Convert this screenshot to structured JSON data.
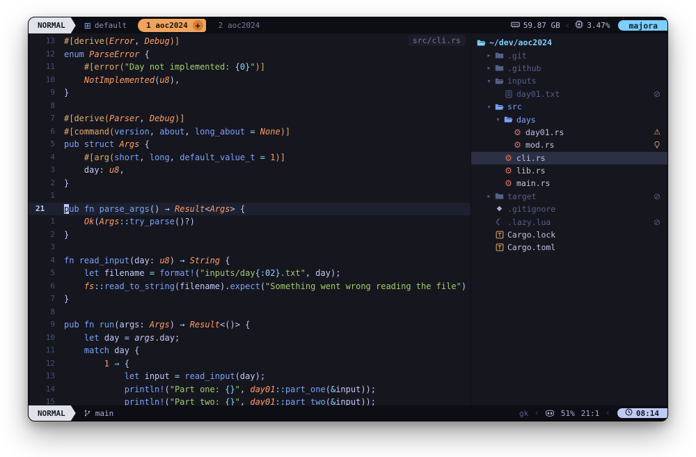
{
  "colors": {
    "bg": "#16161f",
    "bgDark": "#0d0e14",
    "fg": "#c0caf5",
    "uiFg": "#a9b1d6",
    "dim": "#565f89",
    "gutter": "#475072",
    "cursorline": "#1d202f",
    "selRow": "#2b3045",
    "badge": "#e0e2ea",
    "badgeText": "#15161e",
    "tabActive": "#efa45e",
    "tabActiveText": "#1f1204",
    "tabPlus": "#d87f35",
    "host": "#7dcfff",
    "kw": "#7aa2f7",
    "fn": "#7aa2f7",
    "ty": "#ff9e64",
    "st": "#9ece6a",
    "op": "#89ddff",
    "at": "#e0af68",
    "nu": "#ff9e64",
    "pa": "#7aa2f7",
    "warn": "#e0af68",
    "rust": "#e0705c",
    "folderBlue": "#7aa2f7",
    "toml": "#e0af68",
    "moon": "#7a84b8",
    "diamond": "#a6adc8",
    "timeBg": "#c0caf5"
  },
  "icons": {
    "grid": "⊞",
    "plus": "+",
    "sep": "‹",
    "chevOpen": "▾",
    "chevClosed": "▸",
    "ignored": "⊘",
    "warning": "⚠",
    "rust": "⚙",
    "diamond": "◆",
    "moon": "☾"
  },
  "tabline": {
    "mode": "NORMAL",
    "tabs": [
      {
        "label": "default"
      },
      {
        "label": "1 aoc2024",
        "active": true
      },
      {
        "label": "2 aoc2024"
      }
    ],
    "ram": "59.87 GB",
    "cpu": "3.47%",
    "host": "majora"
  },
  "editor": {
    "file_path": "src/cli.rs",
    "lines": [
      {
        "num": "13",
        "tokens": [
          [
            "at",
            "#[derive("
          ],
          [
            "ty",
            "Error"
          ],
          [
            "pu",
            ", "
          ],
          [
            "ty",
            "Debug"
          ],
          [
            "at",
            ")]"
          ]
        ]
      },
      {
        "num": "12",
        "tokens": [
          [
            "kw",
            "enum "
          ],
          [
            "ty",
            "ParseError"
          ],
          [
            "pu",
            " {"
          ]
        ]
      },
      {
        "num": "11",
        "tokens": [
          [
            "pu",
            "    "
          ],
          [
            "at",
            "#[error("
          ],
          [
            "st",
            "\"Day not implemented: "
          ],
          [
            "fm",
            "{0}"
          ],
          [
            "st",
            "\""
          ],
          [
            "at",
            ")]"
          ]
        ]
      },
      {
        "num": "10",
        "tokens": [
          [
            "pu",
            "    "
          ],
          [
            "ty",
            "NotImplemented"
          ],
          [
            "pu",
            "("
          ],
          [
            "ty",
            "u8"
          ],
          [
            "pu",
            "),"
          ]
        ]
      },
      {
        "num": "9",
        "tokens": [
          [
            "pu",
            "}"
          ]
        ]
      },
      {
        "num": "8",
        "tokens": []
      },
      {
        "num": "7",
        "tokens": [
          [
            "at",
            "#[derive("
          ],
          [
            "ty",
            "Parser"
          ],
          [
            "pu",
            ", "
          ],
          [
            "ty",
            "Debug"
          ],
          [
            "at",
            ")]"
          ]
        ]
      },
      {
        "num": "6",
        "tokens": [
          [
            "at",
            "#[command("
          ],
          [
            "pa",
            "version"
          ],
          [
            "pu",
            ", "
          ],
          [
            "pa",
            "about"
          ],
          [
            "pu",
            ", "
          ],
          [
            "pa",
            "long_about"
          ],
          [
            "op",
            " = "
          ],
          [
            "ty",
            "None"
          ],
          [
            "at",
            ")]"
          ]
        ]
      },
      {
        "num": "5",
        "tokens": [
          [
            "kw",
            "pub struct "
          ],
          [
            "ty",
            "Args"
          ],
          [
            "pu",
            " {"
          ]
        ]
      },
      {
        "num": "4",
        "tokens": [
          [
            "pu",
            "    "
          ],
          [
            "at",
            "#[arg("
          ],
          [
            "pa",
            "short"
          ],
          [
            "pu",
            ", "
          ],
          [
            "pa",
            "long"
          ],
          [
            "pu",
            ", "
          ],
          [
            "pa",
            "default_value_t"
          ],
          [
            "op",
            " = "
          ],
          [
            "nu",
            "1"
          ],
          [
            "at",
            ")]"
          ]
        ]
      },
      {
        "num": "3",
        "tokens": [
          [
            "pu",
            "    "
          ],
          [
            "tx",
            "day"
          ],
          [
            "pu",
            ": "
          ],
          [
            "ty",
            "u8"
          ],
          [
            "pu",
            ","
          ]
        ]
      },
      {
        "num": "2",
        "tokens": [
          [
            "pu",
            "}"
          ]
        ]
      },
      {
        "num": "1",
        "tokens": []
      },
      {
        "num": "21",
        "current": true,
        "cursor": true,
        "tokens": [
          [
            "kw",
            "pub fn "
          ],
          [
            "fn",
            "parse_args"
          ],
          [
            "pu",
            "() "
          ],
          [
            "op",
            "→"
          ],
          [
            "pu",
            " "
          ],
          [
            "ty",
            "Result"
          ],
          [
            "pu",
            "<"
          ],
          [
            "ty",
            "Args"
          ],
          [
            "pu",
            "> {"
          ]
        ]
      },
      {
        "num": "1",
        "tokens": [
          [
            "pu",
            "    "
          ],
          [
            "ty",
            "Ok"
          ],
          [
            "pu",
            "("
          ],
          [
            "ty",
            "Args"
          ],
          [
            "op",
            "::"
          ],
          [
            "fn",
            "try_parse"
          ],
          [
            "pu",
            "()?)"
          ]
        ]
      },
      {
        "num": "2",
        "tokens": [
          [
            "pu",
            "}"
          ]
        ]
      },
      {
        "num": "3",
        "tokens": []
      },
      {
        "num": "4",
        "tokens": [
          [
            "kw",
            "fn "
          ],
          [
            "fn",
            "read_input"
          ],
          [
            "pu",
            "("
          ],
          [
            "tx",
            "day"
          ],
          [
            "pu",
            ": "
          ],
          [
            "ty",
            "u8"
          ],
          [
            "pu",
            ") "
          ],
          [
            "op",
            "→"
          ],
          [
            "pu",
            " "
          ],
          [
            "ty",
            "String"
          ],
          [
            "pu",
            " {"
          ]
        ]
      },
      {
        "num": "5",
        "tokens": [
          [
            "pu",
            "    "
          ],
          [
            "kw",
            "let "
          ],
          [
            "tx",
            "filename"
          ],
          [
            "op",
            " = "
          ],
          [
            "fn",
            "format!"
          ],
          [
            "pu",
            "("
          ],
          [
            "st",
            "\"inputs/day"
          ],
          [
            "fm",
            "{:02}"
          ],
          [
            "st",
            ".txt\""
          ],
          [
            "pu",
            ", "
          ],
          [
            "tx",
            "day"
          ],
          [
            "pu",
            ");"
          ]
        ]
      },
      {
        "num": "6",
        "tokens": [
          [
            "pu",
            "    "
          ],
          [
            "ty",
            "fs"
          ],
          [
            "op",
            "::"
          ],
          [
            "fn",
            "read_to_string"
          ],
          [
            "pu",
            "("
          ],
          [
            "tx",
            "filename"
          ],
          [
            "pu",
            ")."
          ],
          [
            "fn",
            "expect"
          ],
          [
            "pu",
            "("
          ],
          [
            "st",
            "\"Something went wrong reading the file\""
          ],
          [
            "pu",
            ")"
          ]
        ]
      },
      {
        "num": "7",
        "tokens": [
          [
            "pu",
            "}"
          ]
        ]
      },
      {
        "num": "8",
        "tokens": []
      },
      {
        "num": "9",
        "tokens": [
          [
            "kw",
            "pub fn "
          ],
          [
            "fn",
            "run"
          ],
          [
            "pu",
            "("
          ],
          [
            "tx",
            "args"
          ],
          [
            "pu",
            ": "
          ],
          [
            "ty",
            "Args"
          ],
          [
            "pu",
            ") "
          ],
          [
            "op",
            "→"
          ],
          [
            "pu",
            " "
          ],
          [
            "ty",
            "Result"
          ],
          [
            "pu",
            "<()> {"
          ]
        ]
      },
      {
        "num": "10",
        "tokens": [
          [
            "pu",
            "    "
          ],
          [
            "kw",
            "let "
          ],
          [
            "tx",
            "day"
          ],
          [
            "op",
            " = "
          ],
          [
            "itx",
            "args"
          ],
          [
            "pu",
            "."
          ],
          [
            "tx",
            "day"
          ],
          [
            "pu",
            ";"
          ]
        ]
      },
      {
        "num": "11",
        "tokens": [
          [
            "pu",
            "    "
          ],
          [
            "kw",
            "match "
          ],
          [
            "tx",
            "day"
          ],
          [
            "pu",
            " {"
          ]
        ]
      },
      {
        "num": "12",
        "tokens": [
          [
            "pu",
            "        "
          ],
          [
            "nu",
            "1"
          ],
          [
            "op",
            " ⇒ "
          ],
          [
            "pu",
            "{"
          ]
        ]
      },
      {
        "num": "13",
        "tokens": [
          [
            "pu",
            "            "
          ],
          [
            "kw",
            "let "
          ],
          [
            "tx",
            "input"
          ],
          [
            "op",
            " = "
          ],
          [
            "fn",
            "read_input"
          ],
          [
            "pu",
            "("
          ],
          [
            "tx",
            "day"
          ],
          [
            "pu",
            ");"
          ]
        ]
      },
      {
        "num": "14",
        "tokens": [
          [
            "pu",
            "            "
          ],
          [
            "fn",
            "println!"
          ],
          [
            "pu",
            "("
          ],
          [
            "st",
            "\"Part one: "
          ],
          [
            "fm",
            "{}"
          ],
          [
            "st",
            "\""
          ],
          [
            "pu",
            ", "
          ],
          [
            "ty",
            "day01"
          ],
          [
            "op",
            "::"
          ],
          [
            "fn",
            "part_one"
          ],
          [
            "pu",
            "("
          ],
          [
            "op",
            "&"
          ],
          [
            "tx",
            "input"
          ],
          [
            "pu",
            "));"
          ]
        ]
      },
      {
        "num": "15",
        "tokens": [
          [
            "pu",
            "            "
          ],
          [
            "fn",
            "println!"
          ],
          [
            "pu",
            "("
          ],
          [
            "st",
            "\"Part two: "
          ],
          [
            "fm",
            "{}"
          ],
          [
            "st",
            "\""
          ],
          [
            "pu",
            ", "
          ],
          [
            "ty",
            "day01"
          ],
          [
            "op",
            "::"
          ],
          [
            "fn",
            "part_two"
          ],
          [
            "pu",
            "("
          ],
          [
            "op",
            "&"
          ],
          [
            "tx",
            "input"
          ],
          [
            "pu",
            "));"
          ]
        ]
      }
    ]
  },
  "filetree": {
    "items": [
      {
        "indent": 0,
        "chevron": "none",
        "icon": "folder-open",
        "color": "host",
        "label": "~/dev/aoc2024",
        "cls": "root"
      },
      {
        "indent": 1,
        "chevron": "closed",
        "icon": "folder",
        "color": "dim",
        "label": ".git",
        "cls": "dim"
      },
      {
        "indent": 1,
        "chevron": "closed",
        "icon": "folder",
        "color": "dim",
        "label": ".github",
        "cls": "dim"
      },
      {
        "indent": 1,
        "chevron": "open",
        "icon": "folder-open",
        "color": "dim",
        "label": "inputs",
        "cls": "dim"
      },
      {
        "indent": 2,
        "chevron": "slot",
        "icon": "file-lines",
        "color": "dim",
        "label": "day01.txt",
        "cls": "dim",
        "right": "ignored"
      },
      {
        "indent": 1,
        "chevron": "open",
        "icon": "folder-open",
        "color": "folderBlue",
        "label": "src",
        "cls": "folder"
      },
      {
        "indent": 2,
        "chevron": "open",
        "icon": "folder-open",
        "color": "folderBlue",
        "label": "days",
        "cls": "folder"
      },
      {
        "indent": 3,
        "chevron": "slot",
        "icon": "rust",
        "color": "rust",
        "label": "day01.rs",
        "cls": "file",
        "right": "warning"
      },
      {
        "indent": 3,
        "chevron": "slot",
        "icon": "rust",
        "color": "rust",
        "label": "mod.rs",
        "cls": "file",
        "right": "hint"
      },
      {
        "indent": 2,
        "chevron": "slot",
        "icon": "rust",
        "color": "rust",
        "label": "cli.rs",
        "cls": "file",
        "selected": true
      },
      {
        "indent": 2,
        "chevron": "slot",
        "icon": "rust",
        "color": "rust",
        "label": "lib.rs",
        "cls": "file"
      },
      {
        "indent": 2,
        "chevron": "slot",
        "icon": "rust",
        "color": "rust",
        "label": "main.rs",
        "cls": "file"
      },
      {
        "indent": 1,
        "chevron": "closed",
        "icon": "folder",
        "color": "dim",
        "label": "target",
        "cls": "dim",
        "right": "ignored"
      },
      {
        "indent": 1,
        "chevron": "slot",
        "icon": "git-diamond",
        "color": "diamond",
        "label": ".gitignore",
        "cls": "dim"
      },
      {
        "indent": 1,
        "chevron": "slot",
        "icon": "moon",
        "color": "moon",
        "label": ".lazy.lua",
        "cls": "dim",
        "right": "ignored"
      },
      {
        "indent": 1,
        "chevron": "slot",
        "icon": "toml",
        "color": "toml",
        "label": "Cargo.lock",
        "cls": "file"
      },
      {
        "indent": 1,
        "chevron": "slot",
        "icon": "toml",
        "color": "toml",
        "label": "Cargo.toml",
        "cls": "file"
      }
    ]
  },
  "statusline": {
    "mode": "NORMAL",
    "branch": "main",
    "keys": "gk",
    "scroll": "51%",
    "position": "21:1",
    "time": "08:14"
  }
}
